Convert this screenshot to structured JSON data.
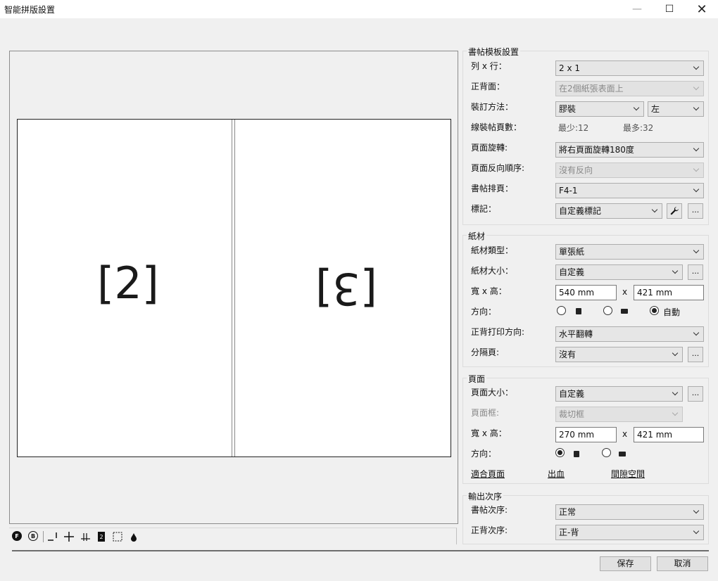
{
  "window": {
    "title": "智能拼版設置",
    "minimize": "—",
    "maximize": "☐",
    "close": "✕"
  },
  "preview": {
    "left_page": "[2]",
    "right_page": "[3]"
  },
  "toolbar": {
    "f_label": "F",
    "b_label": "B"
  },
  "signature": {
    "group_label": "書帖模板設置",
    "rows_cols_label": "列 x 行：",
    "rows_cols_value": "2 x 1",
    "duplex_label": "正背面：",
    "duplex_value": "在2個紙張表面上",
    "binding_label": "裝訂方法：",
    "binding_value": "膠裝",
    "binding_side": "左",
    "sew_label": "線裝帖頁數：",
    "sew_min": "最少:12",
    "sew_max": "最多:32",
    "rotation_label": "頁面旋轉:",
    "rotation_value": "將右頁面旋轉180度",
    "reverse_label": "頁面反向順序:",
    "reverse_value": "沒有反向",
    "imposition_label": "書帖排頁：",
    "imposition_value": "F4-1",
    "marks_label": "標記：",
    "marks_value": "自定義標記",
    "marks_more": "..."
  },
  "paper": {
    "group_label": "紙材",
    "type_label": "紙材類型：",
    "type_value": "單張紙",
    "size_label": "紙材大小：",
    "size_value": "自定義",
    "size_more": "...",
    "wh_label": "寬 x 高：",
    "width": "540 mm",
    "x": "x",
    "height": "421 mm",
    "orient_label": "方向：",
    "auto_label": "自動",
    "duplex_dir_label": "正背打印方向:",
    "duplex_dir_value": "水平翻轉",
    "separator_label": "分隔頁:",
    "separator_value": "沒有",
    "separator_more": "..."
  },
  "page": {
    "group_label": "頁面",
    "size_label": "頁面大小：",
    "size_value": "自定義",
    "size_more": "...",
    "box_label": "頁面框:",
    "box_value": "裁切框",
    "wh_label": "寬 x 高：",
    "width": "270 mm",
    "x": "x",
    "height": "421 mm",
    "orient_label": "方向：",
    "fit_link": "適合頁面",
    "bleed_link": "出血",
    "gap_link": "間隙空間"
  },
  "output": {
    "group_label": "輸出次序",
    "sig_order_label": "書帖次序:",
    "sig_order_value": "正常",
    "fb_order_label": "正背次序:",
    "fb_order_value": "正-背"
  },
  "footer": {
    "save": "保存",
    "cancel": "取消"
  }
}
